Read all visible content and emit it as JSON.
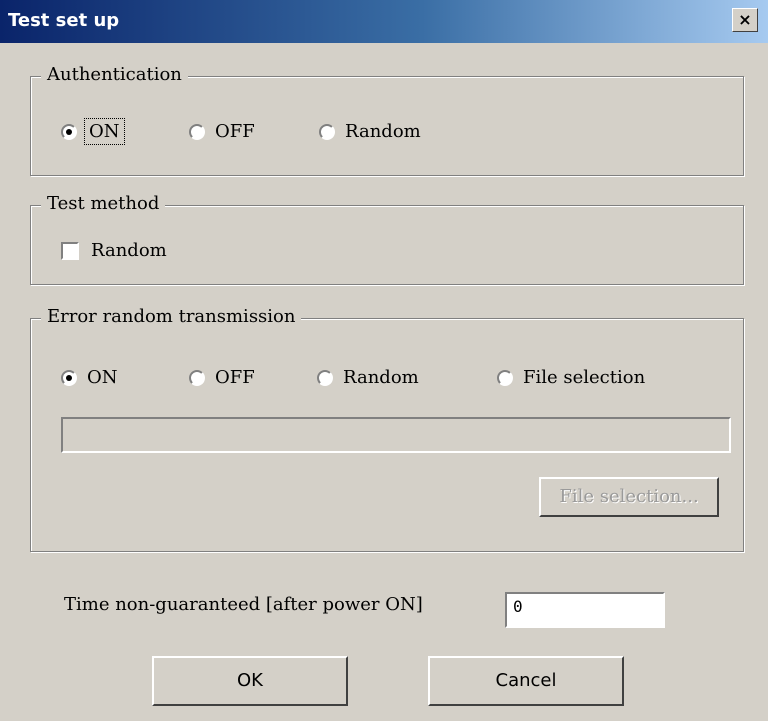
{
  "window": {
    "title": "Test set up",
    "close_glyph": "×"
  },
  "authentication": {
    "legend": "Authentication",
    "options": [
      {
        "label": "ON",
        "checked": true
      },
      {
        "label": "OFF",
        "checked": false
      },
      {
        "label": "Random",
        "checked": false
      }
    ]
  },
  "test_method": {
    "legend": "Test method",
    "random_label": "Random",
    "random_checked": false
  },
  "error_random": {
    "legend": "Error random transmission",
    "options": [
      {
        "label": "ON",
        "checked": true
      },
      {
        "label": "OFF",
        "checked": false
      },
      {
        "label": "Random",
        "checked": false
      },
      {
        "label": "File selection",
        "checked": false
      }
    ],
    "file_path": "",
    "file_button_label": "File selection..."
  },
  "time_non_guaranteed": {
    "label": "Time non-guaranteed [after power ON]",
    "value": "0"
  },
  "buttons": {
    "ok": "OK",
    "cancel": "Cancel"
  }
}
